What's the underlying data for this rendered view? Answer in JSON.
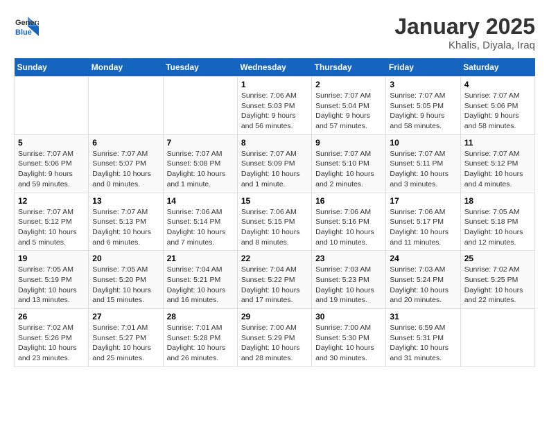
{
  "header": {
    "logo_line1": "General",
    "logo_line2": "Blue",
    "month": "January 2025",
    "location": "Khalis, Diyala, Iraq"
  },
  "weekdays": [
    "Sunday",
    "Monday",
    "Tuesday",
    "Wednesday",
    "Thursday",
    "Friday",
    "Saturday"
  ],
  "weeks": [
    [
      null,
      null,
      null,
      {
        "day": "1",
        "sunrise": "7:06 AM",
        "sunset": "5:03 PM",
        "daylight": "9 hours and 56 minutes."
      },
      {
        "day": "2",
        "sunrise": "7:07 AM",
        "sunset": "5:04 PM",
        "daylight": "9 hours and 57 minutes."
      },
      {
        "day": "3",
        "sunrise": "7:07 AM",
        "sunset": "5:05 PM",
        "daylight": "9 hours and 58 minutes."
      },
      {
        "day": "4",
        "sunrise": "7:07 AM",
        "sunset": "5:06 PM",
        "daylight": "9 hours and 58 minutes."
      }
    ],
    [
      {
        "day": "5",
        "sunrise": "7:07 AM",
        "sunset": "5:06 PM",
        "daylight": "9 hours and 59 minutes."
      },
      {
        "day": "6",
        "sunrise": "7:07 AM",
        "sunset": "5:07 PM",
        "daylight": "10 hours and 0 minutes."
      },
      {
        "day": "7",
        "sunrise": "7:07 AM",
        "sunset": "5:08 PM",
        "daylight": "10 hours and 1 minute."
      },
      {
        "day": "8",
        "sunrise": "7:07 AM",
        "sunset": "5:09 PM",
        "daylight": "10 hours and 1 minute."
      },
      {
        "day": "9",
        "sunrise": "7:07 AM",
        "sunset": "5:10 PM",
        "daylight": "10 hours and 2 minutes."
      },
      {
        "day": "10",
        "sunrise": "7:07 AM",
        "sunset": "5:11 PM",
        "daylight": "10 hours and 3 minutes."
      },
      {
        "day": "11",
        "sunrise": "7:07 AM",
        "sunset": "5:12 PM",
        "daylight": "10 hours and 4 minutes."
      }
    ],
    [
      {
        "day": "12",
        "sunrise": "7:07 AM",
        "sunset": "5:12 PM",
        "daylight": "10 hours and 5 minutes."
      },
      {
        "day": "13",
        "sunrise": "7:07 AM",
        "sunset": "5:13 PM",
        "daylight": "10 hours and 6 minutes."
      },
      {
        "day": "14",
        "sunrise": "7:06 AM",
        "sunset": "5:14 PM",
        "daylight": "10 hours and 7 minutes."
      },
      {
        "day": "15",
        "sunrise": "7:06 AM",
        "sunset": "5:15 PM",
        "daylight": "10 hours and 8 minutes."
      },
      {
        "day": "16",
        "sunrise": "7:06 AM",
        "sunset": "5:16 PM",
        "daylight": "10 hours and 10 minutes."
      },
      {
        "day": "17",
        "sunrise": "7:06 AM",
        "sunset": "5:17 PM",
        "daylight": "10 hours and 11 minutes."
      },
      {
        "day": "18",
        "sunrise": "7:05 AM",
        "sunset": "5:18 PM",
        "daylight": "10 hours and 12 minutes."
      }
    ],
    [
      {
        "day": "19",
        "sunrise": "7:05 AM",
        "sunset": "5:19 PM",
        "daylight": "10 hours and 13 minutes."
      },
      {
        "day": "20",
        "sunrise": "7:05 AM",
        "sunset": "5:20 PM",
        "daylight": "10 hours and 15 minutes."
      },
      {
        "day": "21",
        "sunrise": "7:04 AM",
        "sunset": "5:21 PM",
        "daylight": "10 hours and 16 minutes."
      },
      {
        "day": "22",
        "sunrise": "7:04 AM",
        "sunset": "5:22 PM",
        "daylight": "10 hours and 17 minutes."
      },
      {
        "day": "23",
        "sunrise": "7:03 AM",
        "sunset": "5:23 PM",
        "daylight": "10 hours and 19 minutes."
      },
      {
        "day": "24",
        "sunrise": "7:03 AM",
        "sunset": "5:24 PM",
        "daylight": "10 hours and 20 minutes."
      },
      {
        "day": "25",
        "sunrise": "7:02 AM",
        "sunset": "5:25 PM",
        "daylight": "10 hours and 22 minutes."
      }
    ],
    [
      {
        "day": "26",
        "sunrise": "7:02 AM",
        "sunset": "5:26 PM",
        "daylight": "10 hours and 23 minutes."
      },
      {
        "day": "27",
        "sunrise": "7:01 AM",
        "sunset": "5:27 PM",
        "daylight": "10 hours and 25 minutes."
      },
      {
        "day": "28",
        "sunrise": "7:01 AM",
        "sunset": "5:28 PM",
        "daylight": "10 hours and 26 minutes."
      },
      {
        "day": "29",
        "sunrise": "7:00 AM",
        "sunset": "5:29 PM",
        "daylight": "10 hours and 28 minutes."
      },
      {
        "day": "30",
        "sunrise": "7:00 AM",
        "sunset": "5:30 PM",
        "daylight": "10 hours and 30 minutes."
      },
      {
        "day": "31",
        "sunrise": "6:59 AM",
        "sunset": "5:31 PM",
        "daylight": "10 hours and 31 minutes."
      },
      null
    ]
  ],
  "labels": {
    "sunrise": "Sunrise:",
    "sunset": "Sunset:",
    "daylight": "Daylight:"
  }
}
